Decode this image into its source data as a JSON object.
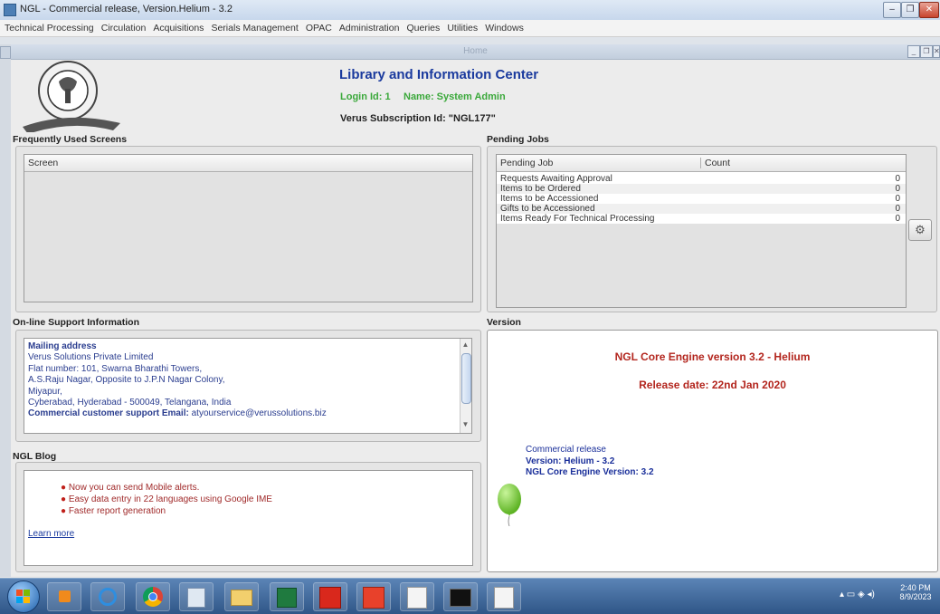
{
  "window": {
    "title": "NGL - Commercial release, Version.Helium - 3.2",
    "controls": [
      "–",
      "❐",
      "✕"
    ]
  },
  "menu": [
    "Technical Processing",
    "Circulation",
    "Acquisitions",
    "Serials Management",
    "OPAC",
    "Administration",
    "Queries",
    "Utilities",
    "Windows"
  ],
  "internal_frame": {
    "title": "Home"
  },
  "header": {
    "org": "Library and Information Center",
    "login_label": "Login Id: 1",
    "name_label": "Name: System Admin",
    "subscription": "Verus Subscription Id: \"NGL177\""
  },
  "frequent": {
    "title": "Frequently Used Screens",
    "column": "Screen"
  },
  "pending": {
    "title": "Pending Jobs",
    "columns": [
      "Pending Job",
      "Count"
    ],
    "rows": [
      {
        "job": "Requests Awaiting Approval",
        "count": "0"
      },
      {
        "job": "Items to be Ordered",
        "count": "0"
      },
      {
        "job": "Items to be Accessioned",
        "count": "0"
      },
      {
        "job": "Gifts to be Accessioned",
        "count": "0"
      },
      {
        "job": "Items Ready For Technical Processing",
        "count": "0"
      }
    ]
  },
  "support": {
    "title": "On-line Support Information",
    "heading": "Mailing address",
    "lines": [
      "Verus Solutions Private Limited",
      "Flat number: 101, Swarna Bharathi Towers,",
      "A.S.Raju Nagar, Opposite to J.P.N Nagar Colony,",
      "Miyapur,",
      "Cyberabad, Hyderabad - 500049, Telangana, India"
    ],
    "email_label": "Commercial customer support Email:",
    "email": "atyourservice@verussolutions.biz"
  },
  "version": {
    "title": "Version",
    "engine": "NGL Core Engine version 3.2 - Helium",
    "release_date": "Release date: 22nd Jan 2020",
    "info": [
      "Commercial release",
      "Version: Helium - 3.2",
      "NGL Core Engine Version: 3.2"
    ]
  },
  "blog": {
    "title": "NGL Blog",
    "items": [
      "Now you can send Mobile alerts.",
      "Easy data entry in 22 languages using Google IME",
      "Faster report generation"
    ],
    "link": "Learn more"
  },
  "taskbar": {
    "time": "2:40 PM",
    "date": "8/9/2023",
    "apps": [
      "windows-media-player",
      "internet-explorer",
      "chrome",
      "notes",
      "folder",
      "excel",
      "pdf-reader",
      "anydesk",
      "java",
      "terminal",
      "java"
    ]
  },
  "colors": {
    "header_blue": "#1a3a9e",
    "login_green": "#3aa83a",
    "engine_red": "#b3261e",
    "info_blue": "#1a2f9a",
    "balloon": "#7cd13c"
  }
}
